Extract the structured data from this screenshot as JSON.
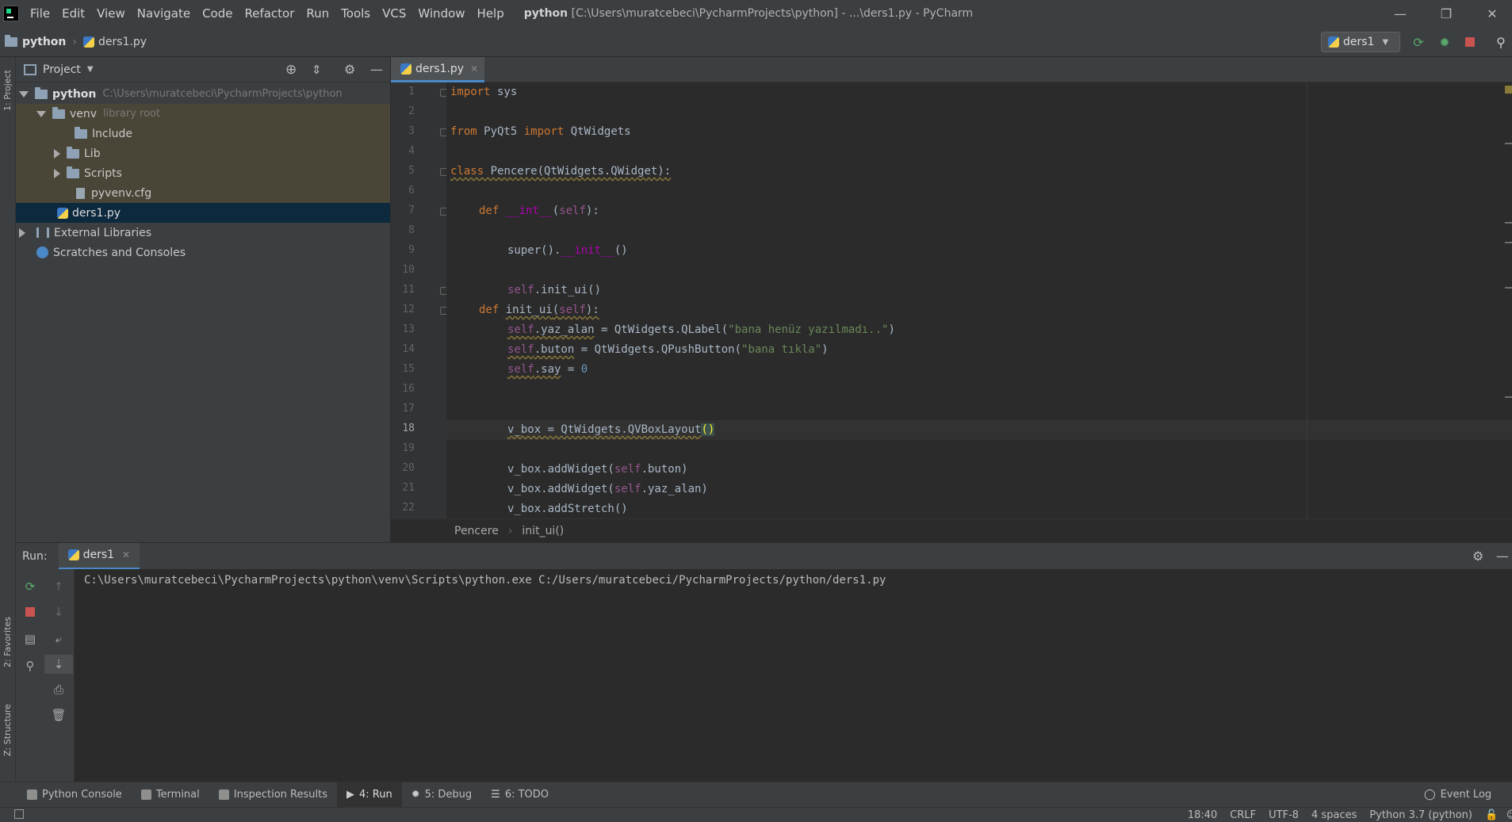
{
  "window": {
    "menu": [
      "File",
      "Edit",
      "View",
      "Navigate",
      "Code",
      "Refactor",
      "Run",
      "Tools",
      "VCS",
      "Window",
      "Help"
    ],
    "project_name": "python",
    "title_rest": "[C:\\Users\\muratcebeci\\PycharmProjects\\python] - ...\\ders1.py - PyCharm",
    "minimize": "—",
    "restore": "❐",
    "close": "✕"
  },
  "navbar": {
    "project": "python",
    "file": "ders1.py",
    "run_config": "ders1"
  },
  "left_strip": {
    "project_label": "1: Project",
    "favorites_label": "2: Favorites",
    "structure_label": "Z: Structure"
  },
  "project_panel": {
    "title": "Project",
    "tree": {
      "root": {
        "name": "python",
        "path": "C:\\Users\\muratcebeci\\PycharmProjects\\python"
      },
      "venv": {
        "name": "venv",
        "note": "library root"
      },
      "include": "Include",
      "lib": "Lib",
      "scripts": "Scripts",
      "pyvenv": "pyvenv.cfg",
      "ders1": "ders1.py",
      "external": "External Libraries",
      "scratches": "Scratches and Consoles"
    }
  },
  "editor": {
    "tab": "ders1.py",
    "current_line": 18,
    "line_numbers": [
      "1",
      "2",
      "3",
      "4",
      "5",
      "6",
      "7",
      "8",
      "9",
      "10",
      "11",
      "12",
      "13",
      "14",
      "15",
      "16",
      "17",
      "18",
      "19",
      "20",
      "21",
      "22"
    ],
    "code": {
      "l1_kw": "import",
      "l1_rest": " sys",
      "l3_kw1": "from",
      "l3_mod": " PyQt5 ",
      "l3_kw2": "import",
      "l3_rest": " QtWidgets",
      "l5_kw": "class",
      "l5_rest": " Pencere(QtWidgets.QWidget):",
      "l7_kw": "def",
      "l7_name": "__int__",
      "l7_open": "(",
      "l7_self": "self",
      "l7_close": "):",
      "l9_a": "super().",
      "l9_init": "__init__",
      "l9_b": "()",
      "l11_self": "self",
      "l11_rest": ".init_ui()",
      "l12_kw": "def",
      "l12_name": "init_ui",
      "l12_open": "(",
      "l12_self": "self",
      "l12_close": "):",
      "l13_self": "self",
      "l13_attr": ".yaz_alan",
      "l13_mid": " = QtWidgets.QLabel(",
      "l13_str": "\"bana henüz yazılmadı..\"",
      "l13_end": ")",
      "l14_self": "self",
      "l14_attr": ".buton",
      "l14_mid": " = QtWidgets.QPushButton(",
      "l14_str": "\"bana tıkla\"",
      "l14_end": ")",
      "l15_self": "self",
      "l15_attr": ".say",
      "l15_mid": " = ",
      "l15_num": "0",
      "l18_a": "v_box = QtWidgets.QVBoxLayout",
      "l18_paren": "()",
      "l20_a": "v_box.addWidget(",
      "l20_self": "self",
      "l20_b": ".buton)",
      "l21_a": "v_box.addWidget(",
      "l21_self": "self",
      "l21_b": ".yaz_alan)",
      "l22": "v_box.addStretch()"
    },
    "breadcrumb": {
      "class": "Pencere",
      "method": "init_ui()"
    }
  },
  "run_panel": {
    "label": "Run:",
    "tab": "ders1",
    "output": "C:\\Users\\muratcebeci\\PycharmProjects\\python\\venv\\Scripts\\python.exe C:/Users/muratcebeci/PycharmProjects/python/ders1.py"
  },
  "tool_windows": [
    {
      "label": "Python Console"
    },
    {
      "label": "Terminal"
    },
    {
      "label": "Inspection Results"
    },
    {
      "label": "4: Run"
    },
    {
      "label": "5: Debug"
    },
    {
      "label": "6: TODO"
    }
  ],
  "event_log": "Event Log",
  "status": {
    "position": "18:40",
    "line_sep": "CRLF",
    "encoding": "UTF-8",
    "indent": "4 spaces",
    "interpreter": "Python 3.7 (python)"
  },
  "colors": {
    "bg": "#2b2b2b",
    "panel": "#3c3f41",
    "keyword": "#cc7832",
    "self": "#94558d",
    "string": "#6a8759",
    "number": "#6897bb",
    "selection": "#0d293e",
    "accent": "#4a88c7"
  }
}
